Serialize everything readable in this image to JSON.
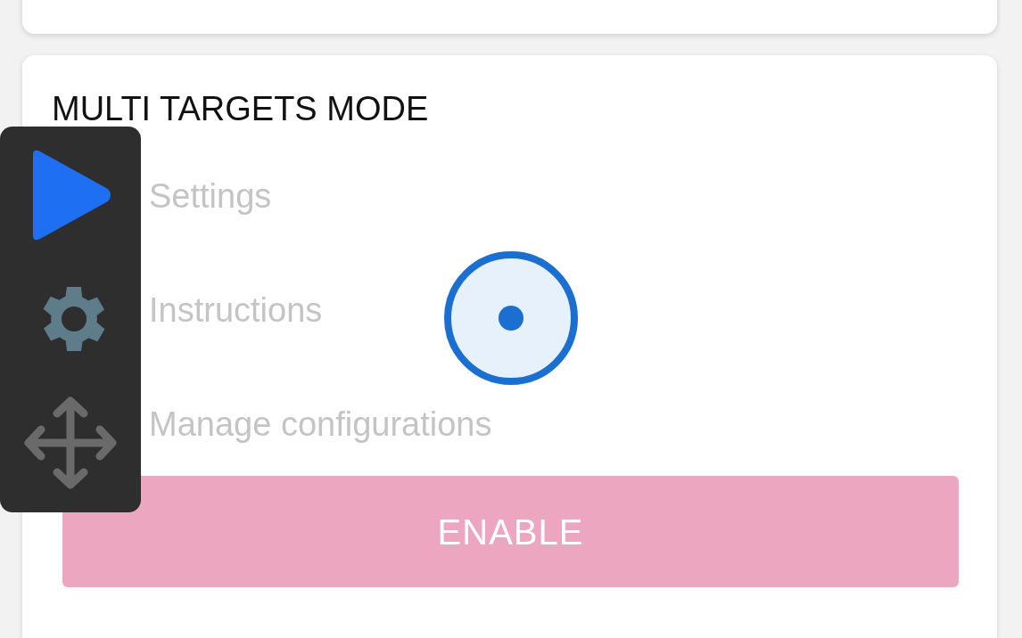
{
  "section": {
    "title": "MULTI TARGETS MODE",
    "items": [
      {
        "label": "Settings",
        "disabled": true
      },
      {
        "label": "Instructions",
        "disabled": true
      },
      {
        "label": "Manage configurations",
        "disabled": true
      }
    ],
    "button": {
      "label": "ENABLE",
      "disabled": true
    }
  },
  "floating_panel": {
    "tools": [
      {
        "kind": "play"
      },
      {
        "kind": "gear"
      },
      {
        "kind": "move"
      }
    ]
  }
}
